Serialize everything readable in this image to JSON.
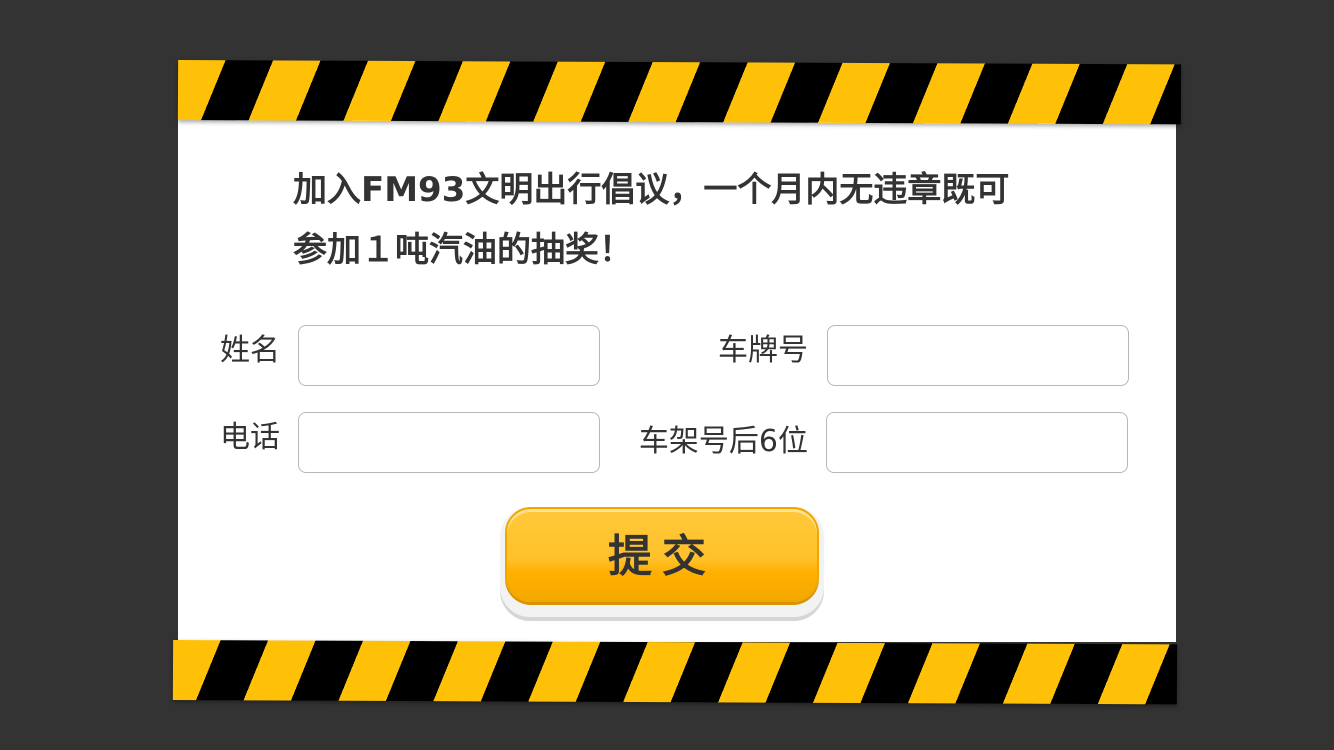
{
  "headline": {
    "line1": "加入FM93文明出行倡议，一个月内无违章既可",
    "line2": "参加１吨汽油的抽奖！"
  },
  "form": {
    "name_label": "姓名",
    "name_value": "",
    "plate_label": "车牌号",
    "plate_value": "",
    "phone_label": "电话",
    "phone_value": "",
    "vin_label": "车架号后6位",
    "vin_value": ""
  },
  "submit": {
    "label": "提交"
  },
  "colors": {
    "background": "#333333",
    "card": "#ffffff",
    "tape_yellow": "#ffc107",
    "tape_black": "#000000",
    "button": "#ffc12a"
  }
}
